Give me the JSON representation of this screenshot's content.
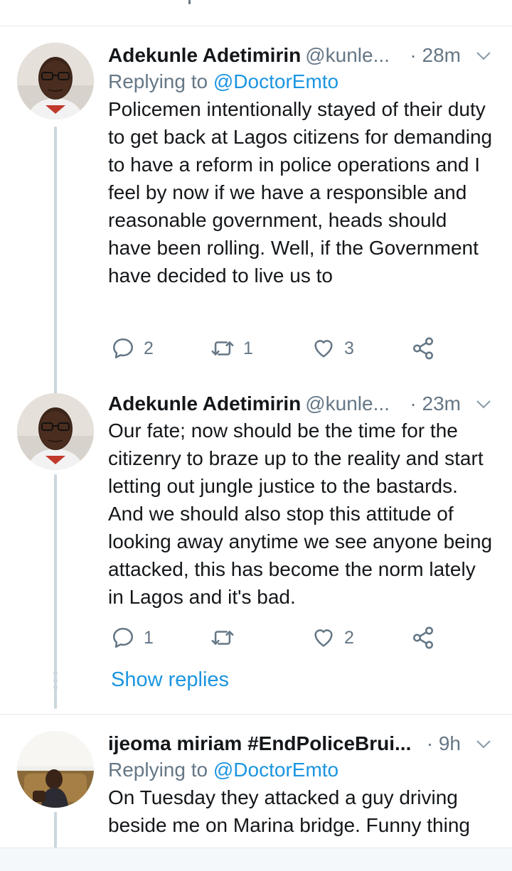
{
  "tweets": [
    {
      "author_name": "Adekunle Adetimirin",
      "handle": "@kunle...",
      "time": "· 28m",
      "replying_prefix": "Replying to",
      "replying_to": "@DoctorEmto",
      "text": "Policemen intentionally stayed of their duty to get back at Lagos citizens for demanding to have a reform in police operations and I feel by now if we have a responsible and reasonable government, heads should have been rolling. Well, if the Government have decided to live us to",
      "reply_count": "2",
      "retweet_count": "1",
      "like_count": "3"
    },
    {
      "author_name": "Adekunle Adetimirin",
      "handle": "@kunle...",
      "time": "· 23m",
      "text": "Our fate; now should be the time for the citizenry to braze up to the reality and start letting out jungle justice to the bastards. And we should also stop this attitude of looking away anytime we see anyone being attacked, this has become the norm lately in Lagos and it's bad.",
      "reply_count": "1",
      "retweet_count": "",
      "like_count": "2"
    },
    {
      "author_name": "ijeoma miriam #EndPoliceBrui...",
      "time": "· 9h",
      "replying_prefix": "Replying to",
      "replying_to": "@DoctorEmto",
      "text": "On Tuesday they attacked a guy driving beside me on Marina bridge. Funny thing"
    }
  ],
  "show_replies_label": "Show replies",
  "icons": {
    "reply": "reply-icon",
    "retweet": "retweet-icon",
    "like": "heart-icon",
    "share": "share-icon",
    "caret": "chevron-down-icon"
  },
  "colors": {
    "link": "#1b95e0",
    "secondary_text": "#657786",
    "thread_line": "#ccd6dd"
  }
}
